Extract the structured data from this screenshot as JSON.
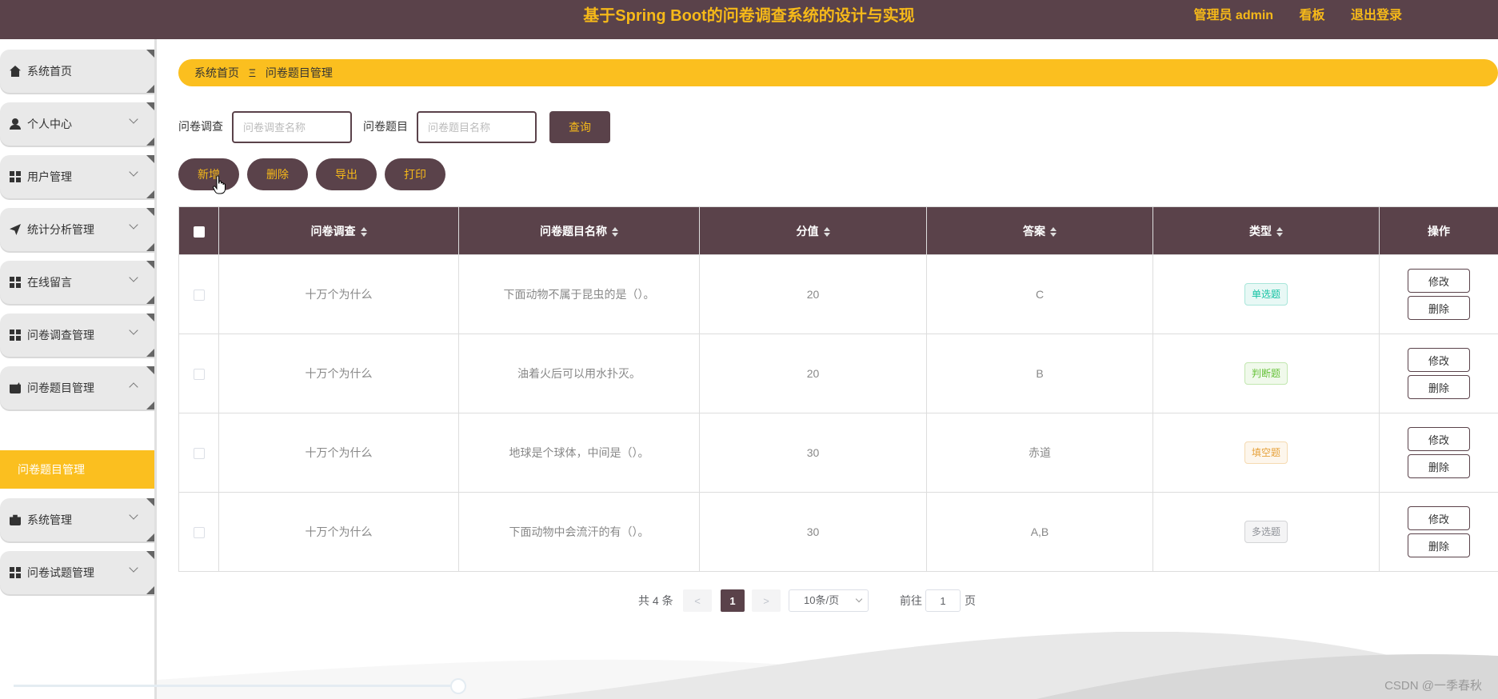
{
  "header": {
    "title": "基于Spring Boot的问卷调查系统的设计与实现",
    "user": "管理员 admin",
    "board": "看板",
    "logout": "退出登录"
  },
  "sidebar": {
    "items": [
      {
        "label": "系统首页",
        "icon": "home-icon"
      },
      {
        "label": "个人中心",
        "icon": "user-icon"
      },
      {
        "label": "用户管理",
        "icon": "grid-icon"
      },
      {
        "label": "统计分析管理",
        "icon": "send-icon"
      },
      {
        "label": "在线留言",
        "icon": "grid-icon"
      },
      {
        "label": "问卷调查管理",
        "icon": "grid-icon"
      },
      {
        "label": "问卷题目管理",
        "icon": "wallet-icon",
        "expanded": true
      },
      {
        "label": "系统管理",
        "icon": "briefcase-icon"
      },
      {
        "label": "问卷试题管理",
        "icon": "grid-icon"
      }
    ],
    "active_sub": "问卷题目管理"
  },
  "breadcrumb": {
    "home": "系统首页",
    "separator": "Ξ",
    "current": "问卷题目管理"
  },
  "search": {
    "survey_label": "问卷调查",
    "survey_placeholder": "问卷调查名称",
    "question_label": "问卷题目",
    "question_placeholder": "问卷题目名称",
    "query_button": "查询"
  },
  "actions": {
    "add": "新增",
    "delete": "删除",
    "export": "导出",
    "print": "打印"
  },
  "table": {
    "columns": [
      "问卷调查",
      "问卷题目名称",
      "分值",
      "答案",
      "类型",
      "操作"
    ],
    "rows": [
      {
        "survey": "十万个为什么",
        "question": "下面动物不属于昆虫的是（）。",
        "score": "20",
        "answer": "C",
        "type": "单选题"
      },
      {
        "survey": "十万个为什么",
        "question": "油着火后可以用水扑灭。",
        "score": "20",
        "answer": "B",
        "type": "判断题"
      },
      {
        "survey": "十万个为什么",
        "question": "地球是个球体，中间是（）。",
        "score": "30",
        "answer": "赤道",
        "type": "填空题"
      },
      {
        "survey": "十万个为什么",
        "question": "下面动物中会流汗的有（）。",
        "score": "30",
        "answer": "A,B",
        "type": "多选题"
      }
    ],
    "edit_label": "修改",
    "delete_label": "删除"
  },
  "tag_colors": {
    "单选题": {
      "color": "#13c2a3",
      "bg": "#e8f8f5",
      "border": "#a8e6da"
    },
    "判断题": {
      "color": "#67c23a",
      "bg": "#f0f9eb",
      "border": "#c2e7b0"
    },
    "填空题": {
      "color": "#e6a23c",
      "bg": "#fdf6ec",
      "border": "#f5dab1"
    },
    "多选题": {
      "color": "#909399",
      "bg": "#f4f4f5",
      "border": "#d3d4d6"
    }
  },
  "pagination": {
    "total": "共 4 条",
    "prev": "<",
    "current": "1",
    "next": ">",
    "page_size": "10条/页",
    "goto_label": "前往",
    "goto_value": "1",
    "page_unit": "页"
  },
  "watermark": "CSDN @一季春秋",
  "colors": {
    "primary": "#5a424a",
    "accent": "#fbbf1f",
    "title": "#f6b919"
  }
}
